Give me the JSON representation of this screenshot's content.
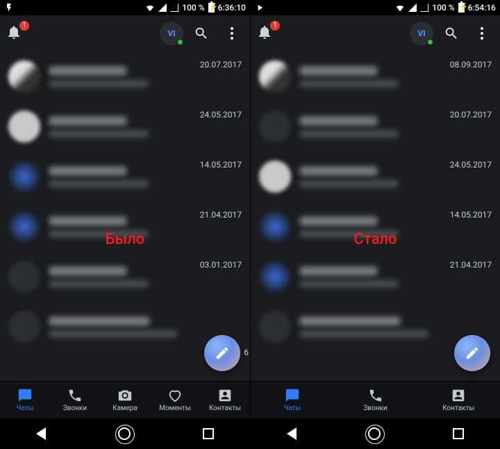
{
  "left": {
    "statusbar": {
      "battery_pct": "100 %",
      "time": "6:36:10"
    },
    "topbar": {
      "badge": "1",
      "avatar_initials": "VI"
    },
    "overlay": "Было",
    "rows": [
      {
        "date": "20.07.2017",
        "av": "grad"
      },
      {
        "date": "24.05.2017",
        "av": "light"
      },
      {
        "date": "14.05.2017",
        "av": "blue"
      },
      {
        "date": "21.04.2017",
        "av": "blue"
      },
      {
        "date": "03.01.2017",
        "av": ""
      },
      {
        "date": "",
        "av": "",
        "fab_side": "6"
      }
    ],
    "bottomnav": [
      {
        "key": "chats",
        "label": "Чаты",
        "active": true,
        "icon": "chat"
      },
      {
        "key": "calls",
        "label": "Звонки",
        "active": false,
        "icon": "phone"
      },
      {
        "key": "camera",
        "label": "Камера",
        "active": false,
        "icon": "camera"
      },
      {
        "key": "moments",
        "label": "Моменты",
        "active": false,
        "icon": "heart"
      },
      {
        "key": "contacts",
        "label": "Контакты",
        "active": false,
        "icon": "contact"
      }
    ]
  },
  "right": {
    "statusbar": {
      "battery_pct": "100 %",
      "time": "6:54:16"
    },
    "topbar": {
      "badge": "1",
      "avatar_initials": "VI"
    },
    "overlay": "Стало",
    "rows": [
      {
        "date": "08.09.2017",
        "av": "grad"
      },
      {
        "date": "20.07.2017",
        "av": ""
      },
      {
        "date": "24.05.2017",
        "av": "light"
      },
      {
        "date": "14.05.2017",
        "av": "blue"
      },
      {
        "date": "21.04.2017",
        "av": "blue"
      },
      {
        "date": "",
        "av": ""
      }
    ],
    "bottomnav": [
      {
        "key": "chats",
        "label": "Чаты",
        "active": true,
        "icon": "chat"
      },
      {
        "key": "calls",
        "label": "Звонки",
        "active": false,
        "icon": "phone"
      },
      {
        "key": "contacts",
        "label": "Контакты",
        "active": false,
        "icon": "contact"
      }
    ]
  }
}
